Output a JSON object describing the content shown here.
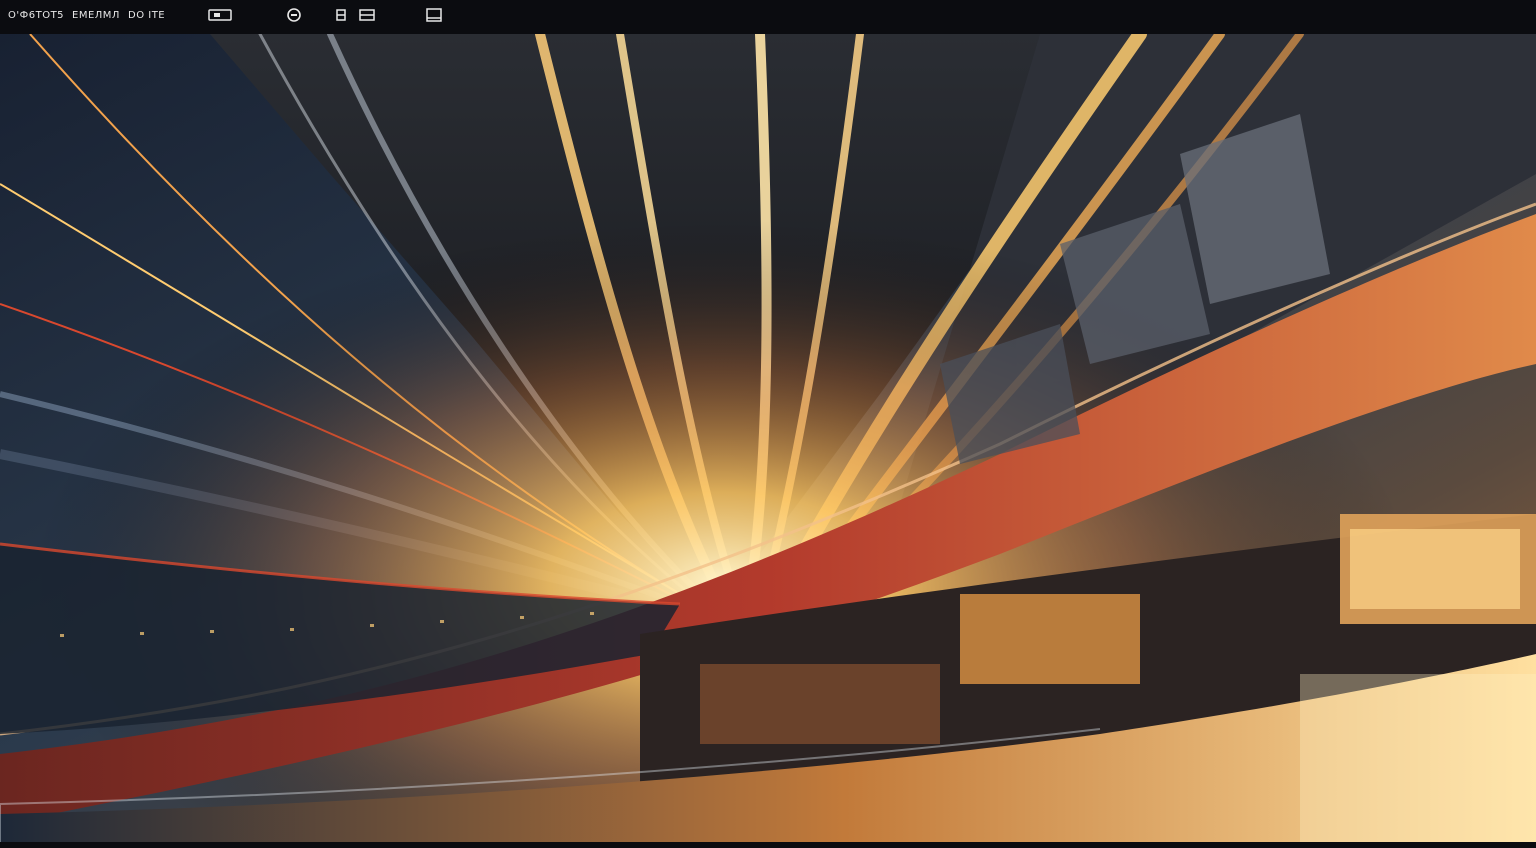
{
  "toolbar": {
    "label_1": "O'Ф6TOT5",
    "label_2": "ЕМЕЛМЛ",
    "label_3": "DO ITE",
    "icons": [
      "window-icon",
      "circle-icon",
      "grid-icon",
      "square-icon"
    ]
  },
  "scene": {
    "description_icon": "futuristic-architecture-image",
    "colors": {
      "sky_dark": "#1c2738",
      "sky_mid": "#3a4a5c",
      "glow": "#ffd27a",
      "accent_red": "#b33a2c",
      "accent_orange": "#e08a3a"
    }
  }
}
